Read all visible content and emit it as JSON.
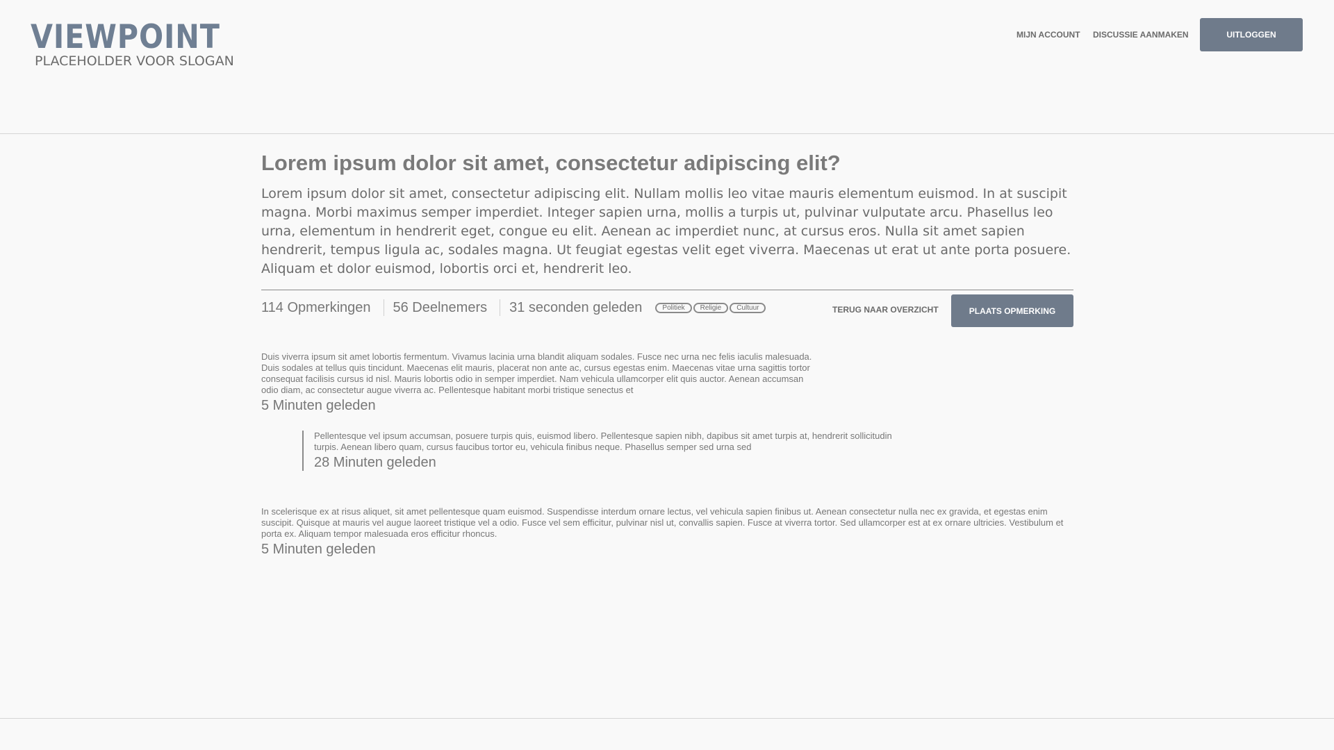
{
  "header": {
    "logo": "VIEWPOINT",
    "slogan": "PLACEHOLDER VOOR SLOGAN",
    "nav": {
      "account": "MIJN ACCOUNT",
      "create_discussion": "DISCUSSIE AANMAKEN",
      "logout": "UITLOGGEN"
    }
  },
  "discussion": {
    "title": "Lorem ipsum dolor sit amet, consectetur adipiscing elit?",
    "body": "Lorem ipsum dolor sit amet, consectetur adipiscing elit. Nullam mollis leo vitae mauris elementum euismod. In at suscipit magna. Morbi maximus semper imperdiet. Integer sapien urna, mollis a turpis ut, pulvinar vulputate arcu. Phasellus leo urna, elementum in hendrerit eget, congue eu elit. Aenean ac imperdiet nunc, at cursus eros. Nulla sit amet sapien hendrerit, tempus ligula ac, sodales magna. Ut feugiat egestas velit eget viverra. Maecenas ut erat ut ante porta posuere. Aliquam et dolor euismod, lobortis orci et, hendrerit leo.",
    "stats": {
      "comments": "114 Opmerkingen",
      "participants": "56 Deelnemers",
      "time": "31 seconden geleden"
    },
    "tags": [
      "Politiek",
      "Religie",
      "Cultuur"
    ],
    "back_label": "TERUG NAAR OVERZICHT",
    "post_comment_label": "PLAATS OPMERKING"
  },
  "comments": [
    {
      "text": "Duis viverra ipsum sit amet lobortis fermentum. Vivamus lacinia urna blandit aliquam sodales. Fusce nec urna nec felis iaculis malesuada. Duis sodales at tellus quis tincidunt. Maecenas elit mauris, placerat non ante ac, cursus egestas enim. Maecenas vitae urna sagittis tortor consequat facilisis cursus id nisl. Mauris lobortis odio in semper imperdiet. Nam vehicula ullamcorper elit quis auctor. Aenean accumsan odio diam, ac consectetur augue viverra ac. Pellentesque habitant morbi tristique senectus et",
      "time": "5 Minuten geleden"
    },
    {
      "text": "Pellentesque vel ipsum accumsan, posuere turpis quis, euismod libero. Pellentesque sapien nibh, dapibus sit amet turpis at, hendrerit sollicitudin turpis. Aenean libero quam, cursus faucibus tortor eu, vehicula finibus neque. Phasellus semper sed urna sed",
      "time": "28 Minuten geleden"
    },
    {
      "text": "In scelerisque ex at risus aliquet, sit amet pellentesque quam euismod. Suspendisse interdum ornare lectus, vel vehicula sapien finibus ut. Aenean consectetur nulla nec ex gravida, et egestas enim suscipit. Quisque at mauris vel augue laoreet tristique vel a odio. Fusce vel sem efficitur, pulvinar nisl ut, convallis sapien. Fusce at viverra tortor. Sed ullamcorper est at ex ornare ultricies. Vestibulum et porta ex. Aliquam tempor malesuada eros efficitur rhoncus.",
      "time": "5 Minuten geleden"
    }
  ],
  "colors": {
    "accent": "#6f7b8b",
    "logo": "#6f7f93",
    "background": "#f9f9f9",
    "text": "#6b6b6b"
  }
}
